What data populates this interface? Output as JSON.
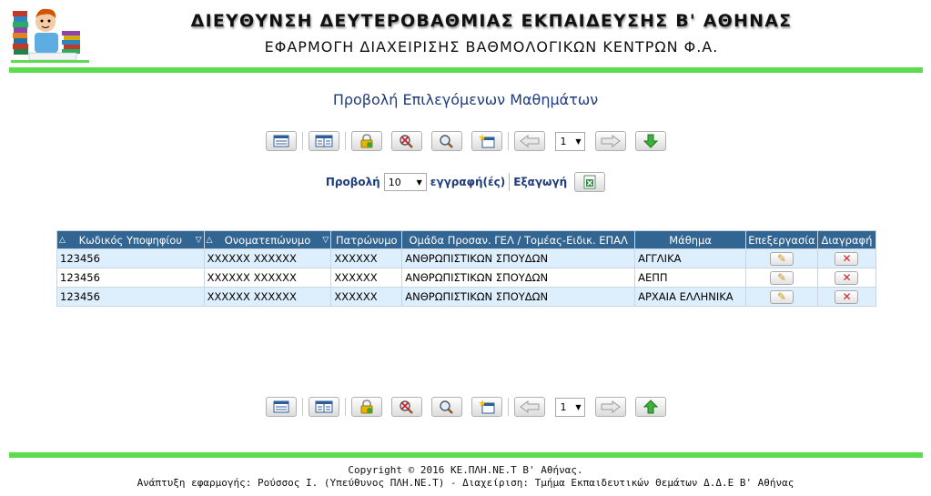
{
  "header": {
    "title": "ΔΙΕΥΘΥΝΣΗ ΔΕΥΤΕΡΟΒΑΘΜΙΑΣ ΕΚΠΑΙΔΕΥΣΗΣ Β' ΑΘΗΝΑΣ",
    "subtitle": "ΕΦΑΡΜΟΓΗ ΔΙΑΧΕΙΡΙΣΗΣ ΒΑΘΜΟΛΟΓΙΚΩΝ ΚΕΝΤΡΩΝ Φ.Α."
  },
  "page": {
    "heading": "Προβολή Επιλεγόμενων Μαθημάτων"
  },
  "pager": {
    "current_page": "1",
    "view_label": "Προβολή",
    "records_per_page": "10",
    "records_label": "εγγραφή(ές)",
    "export_label": "Εξαγωγή"
  },
  "table": {
    "columns": [
      "Κωδικός Υποψηφίου",
      "Ονοματεπώνυμο",
      "Πατρώνυμο",
      "Ομάδα Προσαν. ΓΕΛ / Τομέας-Ειδικ. ΕΠΑΛ",
      "Μάθημα",
      "Επεξεργασία",
      "Διαγραφή"
    ],
    "rows": [
      {
        "code": "123456",
        "name": "XXXXXX XXXXXX",
        "father": "XXXXXX",
        "group": "ΑΝΘΡΩΠΙΣΤΙΚΩΝ ΣΠΟΥΔΩΝ",
        "course": "ΑΓΓΛΙΚΑ"
      },
      {
        "code": "123456",
        "name": "XXXXXX XXXXXX",
        "father": "XXXXXX",
        "group": "ΑΝΘΡΩΠΙΣΤΙΚΩΝ ΣΠΟΥΔΩΝ",
        "course": "ΑΕΠΠ"
      },
      {
        "code": "123456",
        "name": "XXXXXX XXXXXX",
        "father": "XXXXXX",
        "group": "ΑΝΘΡΩΠΙΣΤΙΚΩΝ ΣΠΟΥΔΩΝ",
        "course": "ΑΡΧΑΙΑ ΕΛΛΗΝΙΚΑ"
      }
    ]
  },
  "footer": {
    "copyright": "Copyright © 2016 ΚΕ.ΠΛΗ.ΝΕ.Τ Β' Αθήνας.",
    "credits": "Ανάπτυξη εφαρμογής: Ρούσσος Ι. (Υπεύθυνος ΠΛΗ.ΝΕ.Τ) - Διαχείριση: Τμήμα Εκπαιδευτικών Θεμάτων Δ.Δ.Ε Β' Αθήνας"
  },
  "colors": {
    "accent_green": "#5ddc4f",
    "header_blue": "#336593",
    "heading_blue": "#1f3c7a",
    "row_alt": "#ddeefc"
  },
  "icons": {
    "toolbar": [
      "list-icon",
      "columns-icon",
      "lock-icon",
      "clear-search-icon",
      "search-icon",
      "new-record-icon",
      "prev-page-icon",
      "next-page-icon",
      "down-arrow-icon"
    ],
    "toolbar_bottom": [
      "list-icon",
      "columns-icon",
      "lock-icon",
      "clear-search-icon",
      "search-icon",
      "new-record-icon",
      "prev-page-icon",
      "next-page-icon",
      "up-arrow-icon"
    ],
    "export": "excel-export-icon",
    "edit": "pencil-icon",
    "delete": "delete-x-icon"
  }
}
